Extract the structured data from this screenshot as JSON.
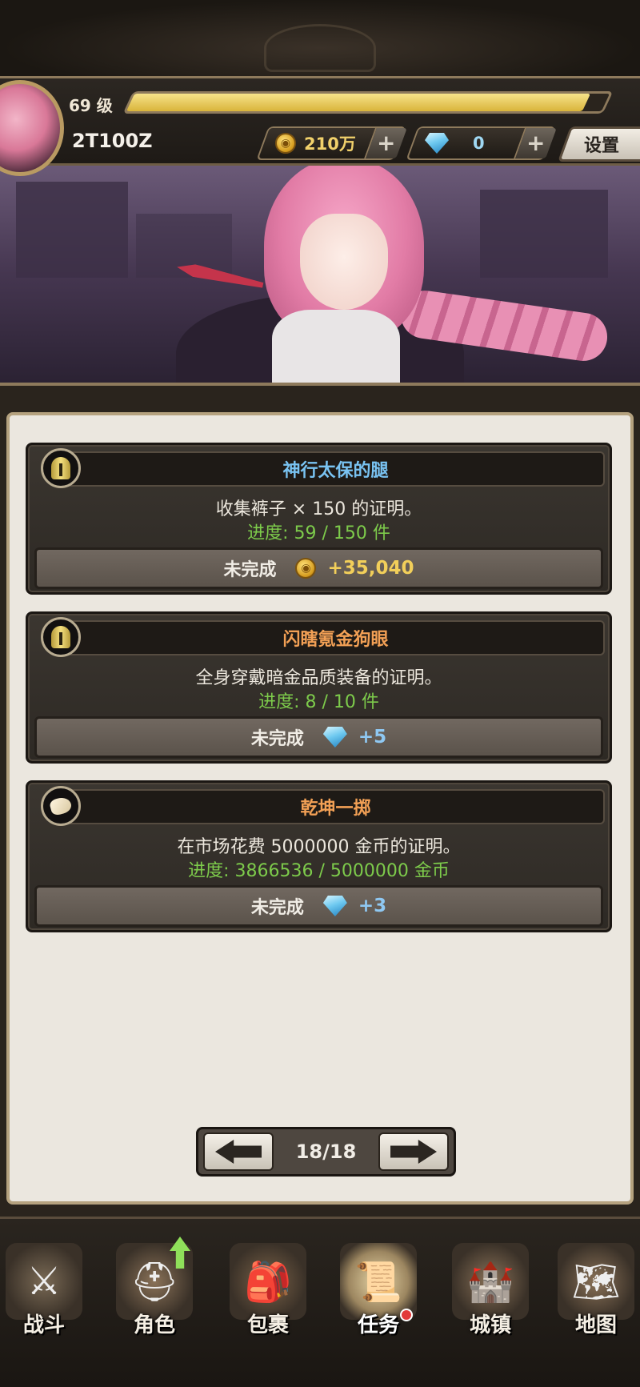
{
  "player": {
    "level_label": "69 级",
    "level_progress": 0.96,
    "name": "2T100Z"
  },
  "currencies": {
    "gold": {
      "icon": "gold-coin-icon",
      "value": "210万",
      "add_label": "+"
    },
    "gems": {
      "icon": "diamond-icon",
      "value": "0",
      "add_label": "+"
    }
  },
  "settings_label": "设置",
  "quests": [
    {
      "icon": "golden-helmet-icon",
      "title": "神行太保的腿",
      "title_color": "#79c3f2",
      "description": "收集裤子 × 150 的证明。",
      "progress": "进度: 59 / 150 件",
      "status": "未完成",
      "reward_icon": "gold-coin-icon",
      "reward": "+35,040",
      "reward_color": "#f2cf5a"
    },
    {
      "icon": "golden-helmet-icon",
      "title": "闪瞎氪金狗眼",
      "title_color": "#f2a055",
      "description": "全身穿戴暗金品质装备的证明。",
      "progress": "进度: 8 / 10 件",
      "status": "未完成",
      "reward_icon": "diamond-icon",
      "reward": "+5",
      "reward_color": "#8fc8f2"
    },
    {
      "icon": "stone-icon",
      "title": "乾坤一掷",
      "title_color": "#f2a055",
      "description": "在市场花费 5000000 金币的证明。",
      "progress": "进度: 3866536 / 5000000 金币",
      "status": "未完成",
      "reward_icon": "diamond-icon",
      "reward": "+3",
      "reward_color": "#8fc8f2"
    }
  ],
  "pagination": {
    "label": "18/18"
  },
  "nav": [
    {
      "label": "战斗",
      "icon": "crossed-swords-shield-icon"
    },
    {
      "label": "角色",
      "icon": "knight-helmet-icon",
      "badge": "upgrade-arrow-icon"
    },
    {
      "label": "包裹",
      "icon": "backpack-icon"
    },
    {
      "label": "任务",
      "icon": "quest-scroll-icon",
      "badge": "notification-dot",
      "active": true
    },
    {
      "label": "城镇",
      "icon": "castle-tower-icon"
    },
    {
      "label": "地图",
      "icon": "map-scroll-icon"
    }
  ]
}
